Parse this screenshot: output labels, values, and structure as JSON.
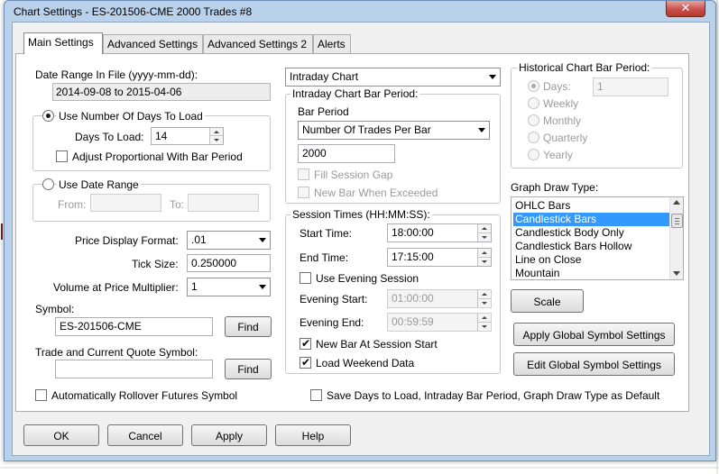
{
  "window": {
    "title": "Chart Settings - ES-201506-CME  2000 Trades  #8",
    "close_glyph": "✕"
  },
  "tabs": [
    {
      "label": "Main Settings",
      "active": true
    },
    {
      "label": "Advanced Settings",
      "active": false
    },
    {
      "label": "Advanced Settings 2",
      "active": false
    },
    {
      "label": "Alerts",
      "active": false
    }
  ],
  "date_range_in_file": {
    "label": "Date Range In File (yyyy-mm-dd):",
    "value": "2014-09-08 to 2015-04-06"
  },
  "days_to_load": {
    "radio_label": "Use Number Of Days To Load",
    "selected": true,
    "days_label": "Days To Load:",
    "days_value": "14",
    "adjust_label": "Adjust Proportional With Bar Period",
    "adjust_checked": false
  },
  "date_range": {
    "radio_label": "Use Date Range",
    "selected": false,
    "from_label": "From:",
    "from_value": "",
    "to_label": "To:",
    "to_value": ""
  },
  "price_display_format": {
    "label": "Price Display Format:",
    "value": ".01"
  },
  "tick_size": {
    "label": "Tick Size:",
    "value": "0.250000"
  },
  "volume_multiplier": {
    "label": "Volume at Price Multiplier:",
    "value": "1"
  },
  "symbol": {
    "label": "Symbol:",
    "value": "ES-201506-CME",
    "find_label": "Find"
  },
  "trade_quote_symbol": {
    "label": "Trade and Current Quote Symbol:",
    "value": "",
    "find_label": "Find"
  },
  "auto_rollover": {
    "label": "Automatically Rollover Futures Symbol",
    "checked": false
  },
  "chart_type": {
    "value": "Intraday Chart"
  },
  "intraday_bar_period": {
    "group_label": "Intraday Chart Bar Period:",
    "bar_period_label": "Bar Period",
    "bar_period_value": "Number Of Trades Per Bar",
    "bar_period_amount": "2000",
    "fill_session_gap_label": "Fill Session Gap",
    "new_bar_when_exceeded_label": "New Bar When Exceeded"
  },
  "session_times": {
    "group_label": "Session Times (HH:MM:SS):",
    "start_label": "Start Time:",
    "start_value": "18:00:00",
    "end_label": "End Time:",
    "end_value": "17:15:00",
    "use_evening_label": "Use Evening Session",
    "use_evening_checked": false,
    "evening_start_label": "Evening Start:",
    "evening_start_value": "01:00:00",
    "evening_end_label": "Evening End:",
    "evening_end_value": "00:59:59",
    "new_bar_at_start_label": "New Bar At Session Start",
    "new_bar_at_start_checked": true,
    "load_weekend_label": "Load Weekend Data",
    "load_weekend_checked": true
  },
  "save_defaults": {
    "label": "Save Days to Load, Intraday Bar Period, Graph Draw Type as Default",
    "checked": false
  },
  "historical_bar_period": {
    "group_label": "Historical Chart Bar Period:",
    "options": [
      {
        "label": "Days:",
        "selected": true
      },
      {
        "label": "Weekly",
        "selected": false
      },
      {
        "label": "Monthly",
        "selected": false
      },
      {
        "label": "Quarterly",
        "selected": false
      },
      {
        "label": "Yearly",
        "selected": false
      }
    ],
    "days_value": "1"
  },
  "graph_draw_type": {
    "label": "Graph Draw Type:",
    "items": [
      "OHLC Bars",
      "Candlestick Bars",
      "Candlestick Body Only",
      "Candlestick Bars Hollow",
      "Line on Close",
      "Mountain"
    ],
    "selected": "Candlestick Bars",
    "scale_label": "Scale"
  },
  "global_buttons": {
    "apply_label": "Apply Global Symbol Settings",
    "edit_label": "Edit Global Symbol Settings"
  },
  "footer_buttons": {
    "ok": "OK",
    "cancel": "Cancel",
    "apply": "Apply",
    "help": "Help"
  },
  "colors": {
    "title_bar": "#b9d1ea",
    "selection": "#3399ff",
    "close_button": "#c75050"
  },
  "glyphs": {
    "check": "✔"
  }
}
